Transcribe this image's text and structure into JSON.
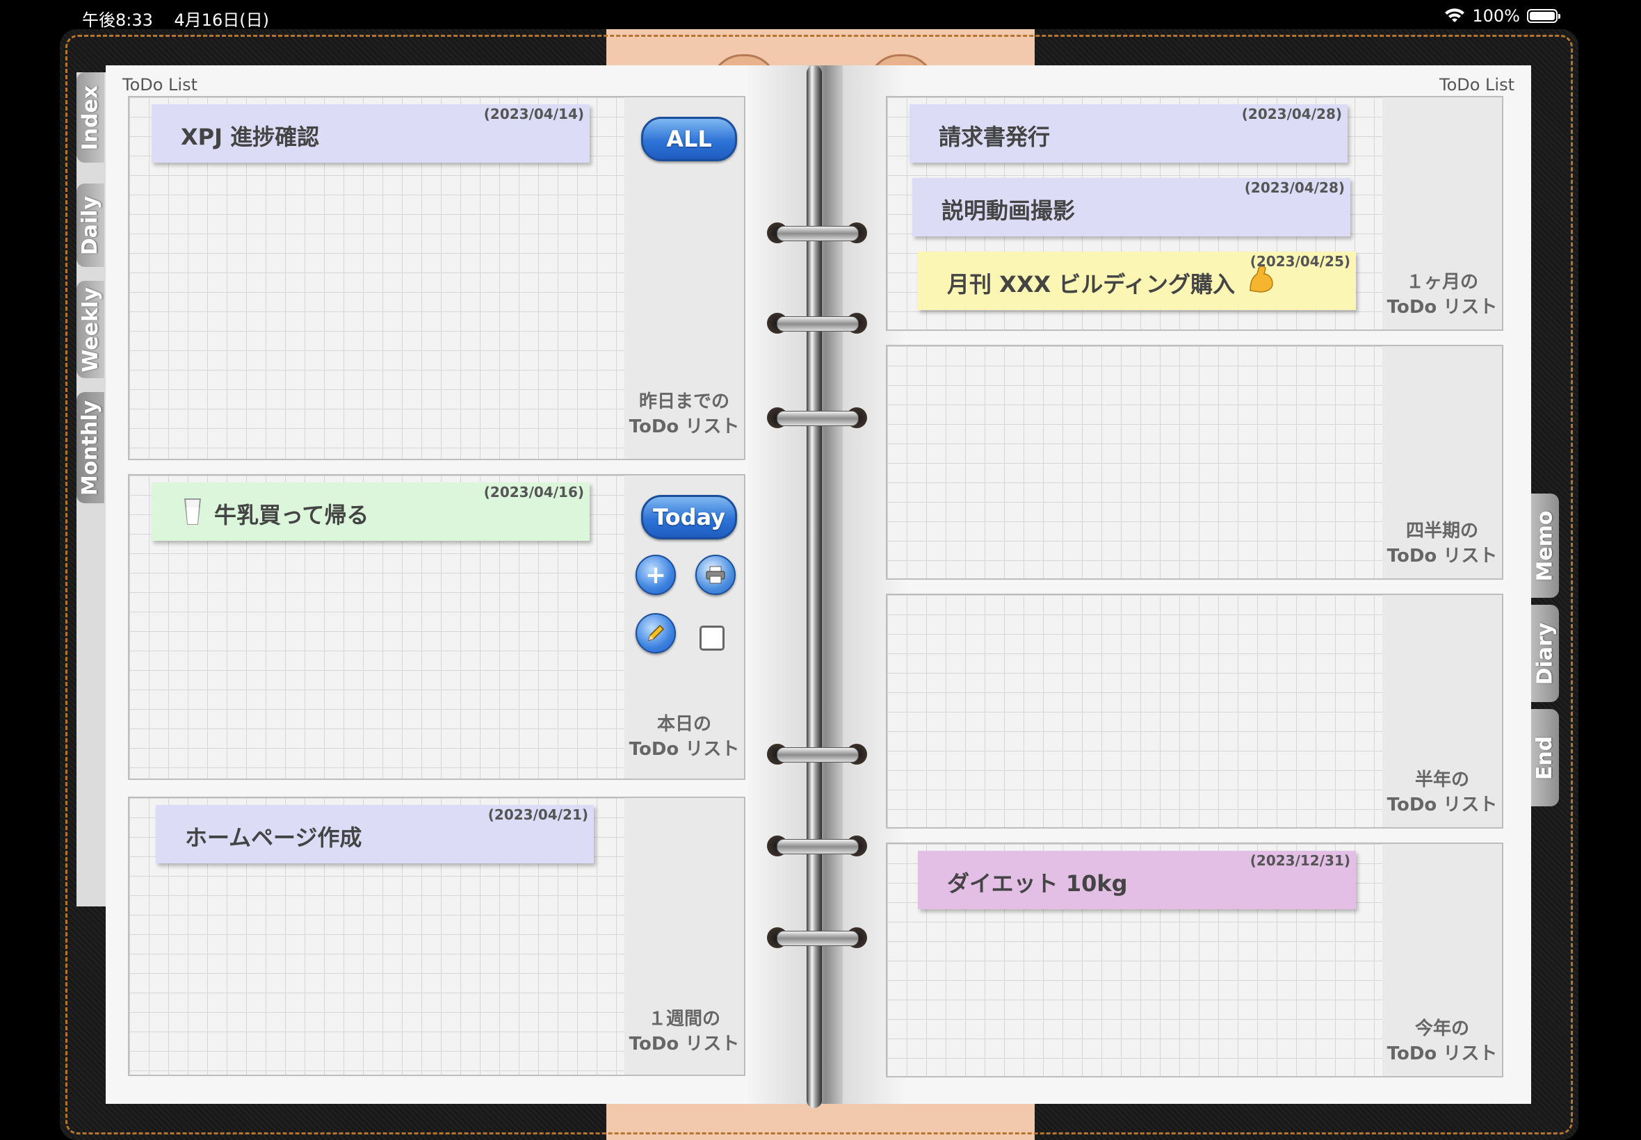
{
  "status_bar": {
    "time": "午後8:33",
    "date": "4月16日(日)",
    "battery": "100%"
  },
  "left_tabs": [
    "Index",
    "Daily",
    "Weekly",
    "Monthly"
  ],
  "right_tabs": [
    "Memo",
    "Diary",
    "End"
  ],
  "left_page": {
    "title": "ToDo List",
    "sections": [
      {
        "label_1": "昨日までの",
        "label_2": "ToDo リスト",
        "cards": [
          {
            "title": "XPJ 進捗確認",
            "date": "(2023/04/14)",
            "color": "#dcdcf6"
          }
        ]
      },
      {
        "label_1": "本日の",
        "label_2": "ToDo リスト",
        "cards": [
          {
            "title": "牛乳買って帰る",
            "date": "(2023/04/16)",
            "color": "#dcf6dc"
          }
        ]
      },
      {
        "label_1": "１週間の",
        "label_2": "ToDo リスト",
        "cards": [
          {
            "title": "ホームページ作成",
            "date": "(2023/04/21)",
            "color": "#dcdcf6"
          }
        ]
      }
    ],
    "buttons": {
      "all": "ALL",
      "today": "Today"
    }
  },
  "right_page": {
    "title": "ToDo List",
    "sections": [
      {
        "label_1": "１ヶ月の",
        "label_2": "ToDo リスト",
        "cards": [
          {
            "title": "請求書発行",
            "date": "(2023/04/28)",
            "color": "#dcdcf6"
          },
          {
            "title": "説明動画撮影",
            "date": "(2023/04/28)",
            "color": "#dcdcf6"
          },
          {
            "title": "月刊 XXX ビルディング購入",
            "date": "(2023/04/25)",
            "color": "#fbf6b4"
          }
        ]
      },
      {
        "label_1": "四半期の",
        "label_2": "ToDo リスト",
        "cards": []
      },
      {
        "label_1": "半年の",
        "label_2": "ToDo リスト",
        "cards": []
      },
      {
        "label_1": "今年の",
        "label_2": "ToDo リスト",
        "cards": [
          {
            "title": "ダイエット 10kg",
            "date": "(2023/12/31)",
            "color": "#e3bfe6"
          }
        ]
      }
    ]
  },
  "icons": {
    "add": "plus-icon",
    "print": "printer-icon",
    "edit": "pencil-icon",
    "milk": "milk-glass-icon",
    "muscle": "flexed-biceps-icon"
  }
}
